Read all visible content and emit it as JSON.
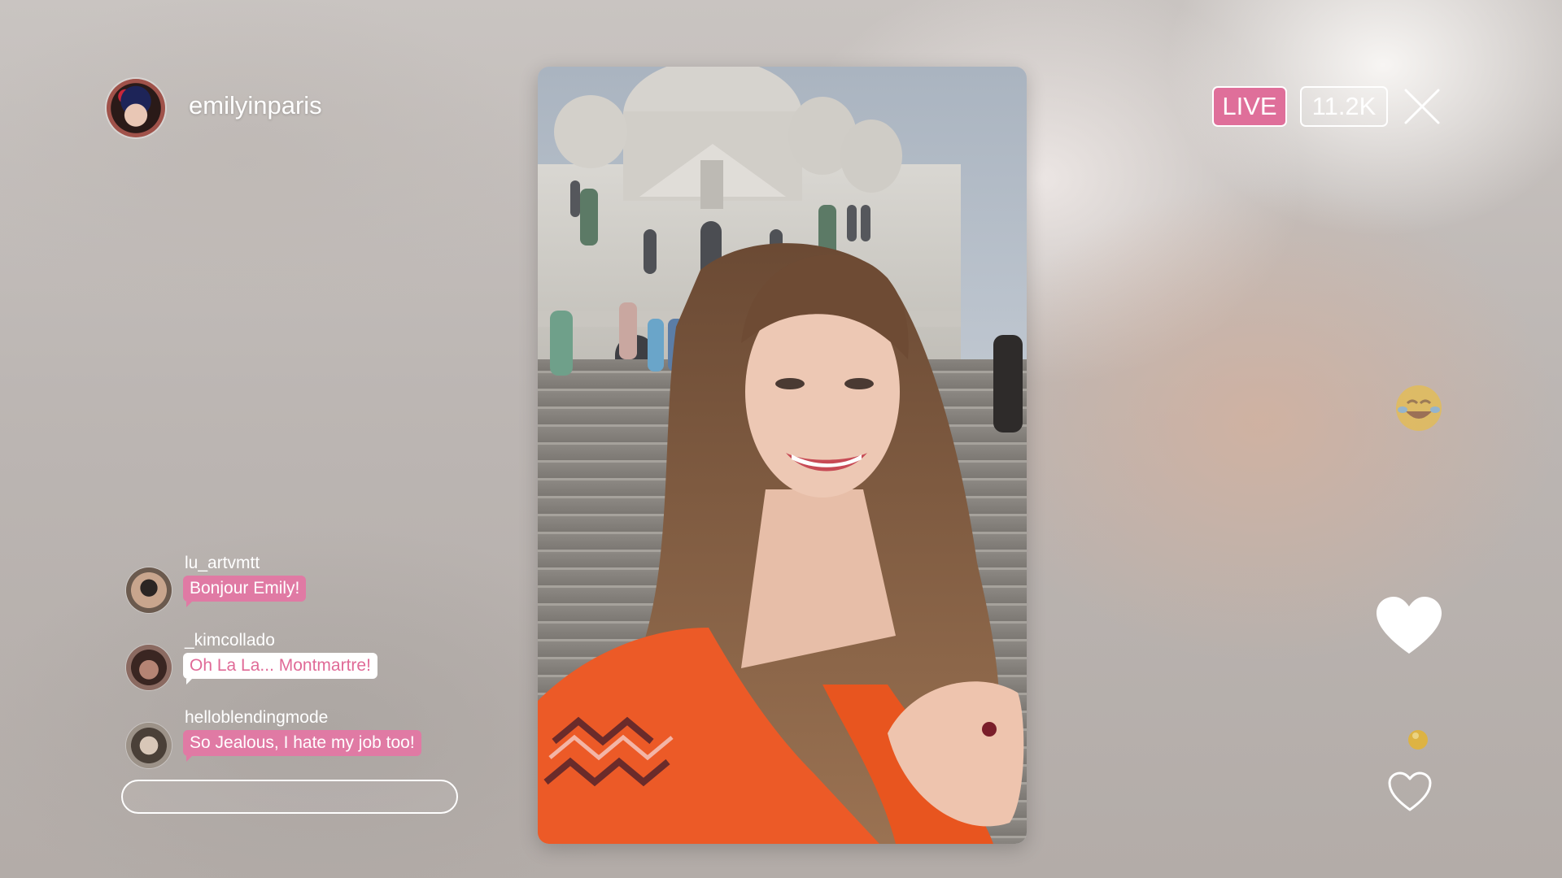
{
  "header": {
    "host_username": "emilyinparis",
    "avatar_icon": "user-avatar",
    "live_label": "LIVE",
    "viewer_count": "11.2K",
    "close_icon": "close-icon"
  },
  "comments": [
    {
      "username": "lu_artvmtt",
      "message": "Bonjour Emily!",
      "bubble_style": "pink"
    },
    {
      "username": "_kimcollado",
      "message": "Oh La La... Montmartre!",
      "bubble_style": "white"
    },
    {
      "username": "helloblendingmode",
      "message": "So Jealous, I hate my job too!",
      "bubble_style": "pink"
    }
  ],
  "comment_input": {
    "placeholder": ""
  },
  "reactions": [
    "laughing-emoji-icon",
    "heart-icon",
    "yellow-orb-icon",
    "heart-outline-icon"
  ],
  "colors": {
    "live_badge": "#df6f9a",
    "comment_bubble_pink": "#e07aa4",
    "comment_text_pink": "#e06a97",
    "reaction_yellow": "#f2c12e"
  }
}
